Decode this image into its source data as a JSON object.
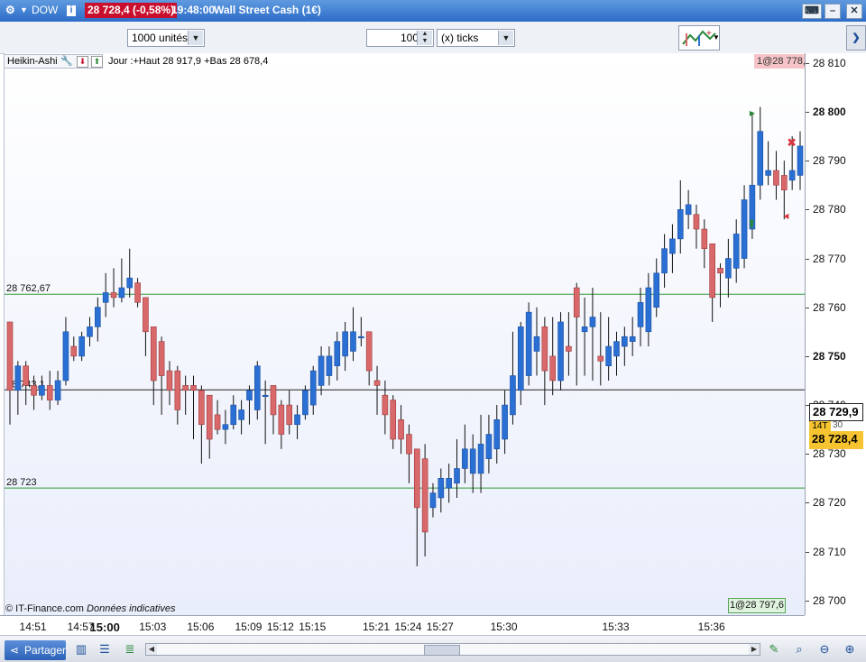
{
  "window": {
    "symbol": "DOW",
    "info_icon": "info-icon",
    "price_change": "28 728,4 (-0,58%)",
    "time": "19:48:00",
    "title": "Wall Street Cash (1€)"
  },
  "toolbar": {
    "quantity": "1000 unités",
    "ticks_value": "100",
    "ticks_unit": "(x) ticks"
  },
  "indicator": {
    "name": "Heikin-Ashi",
    "info": "Jour :+Haut 28 917,9 +Bas 28 678,4"
  },
  "tags": {
    "top_right": "1@28 778,",
    "bottom_right": "1@28 797,6",
    "last_high": "28 729,9",
    "last_price": "28 728,4",
    "countdown": "14T",
    "countdown_partial": "30"
  },
  "copyright": {
    "owner": "© IT-Finance.com",
    "note": "Données indicatives"
  },
  "status": {
    "share_label": "Partager"
  },
  "colors": {
    "up": "#2a6fd4",
    "down": "#d9686a",
    "level_line": "#2e9a3a",
    "price_line": "#222222",
    "badge": "#c8102e",
    "last_price_bg": "#f5c430"
  },
  "chart_data": {
    "type": "candlestick",
    "style": "Heikin-Ashi",
    "ylim": [
      28697,
      28812
    ],
    "yticks": [
      28700,
      28710,
      28720,
      28730,
      28740,
      28750,
      28760,
      28770,
      28780,
      28790,
      28800,
      28810
    ],
    "ytick_labels": [
      "28 700",
      "28 710",
      "28 720",
      "28 730",
      "28 740",
      "28 750",
      "28 760",
      "28 770",
      "28 780",
      "28 790",
      "28 800",
      "28 810"
    ],
    "xtick_labels": [
      "14:51",
      "14:57",
      "15:00",
      "15:03",
      "15:06",
      "15:09",
      "15:12",
      "15:15",
      "15:21",
      "15:24",
      "15:27",
      "15:30",
      "15:33",
      "15:36"
    ],
    "xtick_bar_index": [
      3,
      9,
      12,
      18,
      24,
      30,
      34,
      38,
      46,
      50,
      54,
      62,
      76,
      88
    ],
    "levels": [
      {
        "label": "28 762,67",
        "value": 28762.67,
        "color": "#2e9a3a"
      },
      {
        "label": "28 743,1",
        "value": 28743.1,
        "color": "#222222"
      },
      {
        "label": "28 723",
        "value": 28723,
        "color": "#2e9a3a"
      }
    ],
    "grid": false,
    "candles": [
      {
        "o": 28757,
        "h": 28750,
        "l": 28736,
        "c": 28743
      },
      {
        "o": 28743,
        "h": 28749,
        "l": 28738,
        "c": 28748
      },
      {
        "o": 28748,
        "h": 28749,
        "l": 28740,
        "c": 28744
      },
      {
        "o": 28744,
        "h": 28746,
        "l": 28739,
        "c": 28742
      },
      {
        "o": 28742,
        "h": 28746,
        "l": 28741,
        "c": 28744
      },
      {
        "o": 28744,
        "h": 28747,
        "l": 28739,
        "c": 28741
      },
      {
        "o": 28741,
        "h": 28747,
        "l": 28740,
        "c": 28745
      },
      {
        "o": 28745,
        "h": 28758,
        "l": 28744,
        "c": 28755
      },
      {
        "o": 28752,
        "h": 28754,
        "l": 28749,
        "c": 28750
      },
      {
        "o": 28750,
        "h": 28755,
        "l": 28749,
        "c": 28754
      },
      {
        "o": 28754,
        "h": 28758,
        "l": 28752,
        "c": 28756
      },
      {
        "o": 28756,
        "h": 28762,
        "l": 28753,
        "c": 28760
      },
      {
        "o": 28761,
        "h": 28767,
        "l": 28758,
        "c": 28763
      },
      {
        "o": 28763,
        "h": 28768,
        "l": 28760,
        "c": 28762
      },
      {
        "o": 28762,
        "h": 28770,
        "l": 28761,
        "c": 28764
      },
      {
        "o": 28764,
        "h": 28772,
        "l": 28762,
        "c": 28766
      },
      {
        "o": 28765,
        "h": 28766,
        "l": 28760,
        "c": 28761
      },
      {
        "o": 28762,
        "h": 28762,
        "l": 28750,
        "c": 28755
      },
      {
        "o": 28756,
        "h": 28756,
        "l": 28740,
        "c": 28745
      },
      {
        "o": 28753,
        "h": 28754,
        "l": 28738,
        "c": 28746
      },
      {
        "o": 28747,
        "h": 28749,
        "l": 28740,
        "c": 28743
      },
      {
        "o": 28747,
        "h": 28748,
        "l": 28736,
        "c": 28739
      },
      {
        "o": 28744,
        "h": 28746,
        "l": 28738,
        "c": 28743
      },
      {
        "o": 28744,
        "h": 28746,
        "l": 28733,
        "c": 28743
      },
      {
        "o": 28743,
        "h": 28744,
        "l": 28728,
        "c": 28736
      },
      {
        "o": 28742,
        "h": 28742,
        "l": 28729,
        "c": 28733
      },
      {
        "o": 28738,
        "h": 28741,
        "l": 28734,
        "c": 28735
      },
      {
        "o": 28735,
        "h": 28739,
        "l": 28732,
        "c": 28736
      },
      {
        "o": 28736,
        "h": 28742,
        "l": 28735,
        "c": 28740
      },
      {
        "o": 28737,
        "h": 28741,
        "l": 28734,
        "c": 28739
      },
      {
        "o": 28741,
        "h": 28744,
        "l": 28736,
        "c": 28743
      },
      {
        "o": 28739,
        "h": 28749,
        "l": 28737,
        "c": 28748
      },
      {
        "o": 28742,
        "h": 28745,
        "l": 28732,
        "c": 28742
      },
      {
        "o": 28744,
        "h": 28744,
        "l": 28734,
        "c": 28738
      },
      {
        "o": 28740,
        "h": 28741,
        "l": 28731,
        "c": 28734
      },
      {
        "o": 28740,
        "h": 28743,
        "l": 28734,
        "c": 28736
      },
      {
        "o": 28736,
        "h": 28740,
        "l": 28733,
        "c": 28738
      },
      {
        "o": 28738,
        "h": 28744,
        "l": 28737,
        "c": 28743
      },
      {
        "o": 28740,
        "h": 28748,
        "l": 28738,
        "c": 28747
      },
      {
        "o": 28744,
        "h": 28752,
        "l": 28742,
        "c": 28750
      },
      {
        "o": 28746,
        "h": 28752,
        "l": 28744,
        "c": 28750
      },
      {
        "o": 28748,
        "h": 28755,
        "l": 28745,
        "c": 28753
      },
      {
        "o": 28750,
        "h": 28757,
        "l": 28747,
        "c": 28755
      },
      {
        "o": 28751,
        "h": 28760,
        "l": 28749,
        "c": 28755
      },
      {
        "o": 28754,
        "h": 28758,
        "l": 28752,
        "c": 28754
      },
      {
        "o": 28755,
        "h": 28755,
        "l": 28744,
        "c": 28747
      },
      {
        "o": 28745,
        "h": 28748,
        "l": 28738,
        "c": 28744
      },
      {
        "o": 28742,
        "h": 28745,
        "l": 28734,
        "c": 28738
      },
      {
        "o": 28741,
        "h": 28742,
        "l": 28731,
        "c": 28733
      },
      {
        "o": 28737,
        "h": 28740,
        "l": 28730,
        "c": 28733
      },
      {
        "o": 28734,
        "h": 28736,
        "l": 28724,
        "c": 28730
      },
      {
        "o": 28731,
        "h": 28731,
        "l": 28707,
        "c": 28719
      },
      {
        "o": 28729,
        "h": 28732,
        "l": 28709,
        "c": 28714
      },
      {
        "o": 28719,
        "h": 28724,
        "l": 28717,
        "c": 28722
      },
      {
        "o": 28721,
        "h": 28727,
        "l": 28718,
        "c": 28725
      },
      {
        "o": 28723,
        "h": 28728,
        "l": 28720,
        "c": 28725
      },
      {
        "o": 28724,
        "h": 28733,
        "l": 28721,
        "c": 28727
      },
      {
        "o": 28727,
        "h": 28736,
        "l": 28724,
        "c": 28731
      },
      {
        "o": 28726,
        "h": 28734,
        "l": 28722,
        "c": 28731
      },
      {
        "o": 28726,
        "h": 28738,
        "l": 28722,
        "c": 28732
      },
      {
        "o": 28729,
        "h": 28738,
        "l": 28726,
        "c": 28734
      },
      {
        "o": 28731,
        "h": 28740,
        "l": 28728,
        "c": 28737
      },
      {
        "o": 28733,
        "h": 28743,
        "l": 28730,
        "c": 28740
      },
      {
        "o": 28738,
        "h": 28755,
        "l": 28736,
        "c": 28746
      },
      {
        "o": 28743,
        "h": 28757,
        "l": 28740,
        "c": 28756
      },
      {
        "o": 28746,
        "h": 28761,
        "l": 28744,
        "c": 28759
      },
      {
        "o": 28751,
        "h": 28760,
        "l": 28746,
        "c": 28754
      },
      {
        "o": 28756,
        "h": 28758,
        "l": 28740,
        "c": 28747
      },
      {
        "o": 28750,
        "h": 28758,
        "l": 28742,
        "c": 28745
      },
      {
        "o": 28745,
        "h": 28759,
        "l": 28743,
        "c": 28757
      },
      {
        "o": 28752,
        "h": 28759,
        "l": 28746,
        "c": 28751
      },
      {
        "o": 28764,
        "h": 28765,
        "l": 28744,
        "c": 28758
      },
      {
        "o": 28755,
        "h": 28762,
        "l": 28746,
        "c": 28756
      },
      {
        "o": 28756,
        "h": 28764,
        "l": 28745,
        "c": 28758
      },
      {
        "o": 28750,
        "h": 28759,
        "l": 28744,
        "c": 28749
      },
      {
        "o": 28748,
        "h": 28758,
        "l": 28745,
        "c": 28752
      },
      {
        "o": 28750,
        "h": 28755,
        "l": 28746,
        "c": 28753
      },
      {
        "o": 28752,
        "h": 28756,
        "l": 28748,
        "c": 28754
      },
      {
        "o": 28753,
        "h": 28758,
        "l": 28750,
        "c": 28754
      },
      {
        "o": 28756,
        "h": 28764,
        "l": 28752,
        "c": 28761
      },
      {
        "o": 28755,
        "h": 28767,
        "l": 28752,
        "c": 28764
      },
      {
        "o": 28760,
        "h": 28770,
        "l": 28758,
        "c": 28767
      },
      {
        "o": 28767,
        "h": 28775,
        "l": 28764,
        "c": 28772
      },
      {
        "o": 28771,
        "h": 28777,
        "l": 28767,
        "c": 28774
      },
      {
        "o": 28774,
        "h": 28786,
        "l": 28771,
        "c": 28780
      },
      {
        "o": 28779,
        "h": 28784,
        "l": 28776,
        "c": 28781
      },
      {
        "o": 28779,
        "h": 28781,
        "l": 28772,
        "c": 28776
      },
      {
        "o": 28776,
        "h": 28778,
        "l": 28768,
        "c": 28772
      },
      {
        "o": 28773,
        "h": 28773,
        "l": 28757,
        "c": 28762
      },
      {
        "o": 28768,
        "h": 28769,
        "l": 28760,
        "c": 28767
      },
      {
        "o": 28766,
        "h": 28774,
        "l": 28762,
        "c": 28770
      },
      {
        "o": 28768,
        "h": 28778,
        "l": 28765,
        "c": 28775
      },
      {
        "o": 28770,
        "h": 28785,
        "l": 28768,
        "c": 28782
      },
      {
        "o": 28776,
        "h": 28800,
        "l": 28774,
        "c": 28785
      },
      {
        "o": 28785,
        "h": 28801,
        "l": 28782,
        "c": 28796
      },
      {
        "o": 28787,
        "h": 28794,
        "l": 28785,
        "c": 28788
      },
      {
        "o": 28788,
        "h": 28792,
        "l": 28782,
        "c": 28785
      },
      {
        "o": 28787,
        "h": 28790,
        "l": 28778,
        "c": 28784
      },
      {
        "o": 28786,
        "h": 28795,
        "l": 28784,
        "c": 28788
      },
      {
        "o": 28787,
        "h": 28796,
        "l": 28784,
        "c": 28793
      }
    ]
  }
}
